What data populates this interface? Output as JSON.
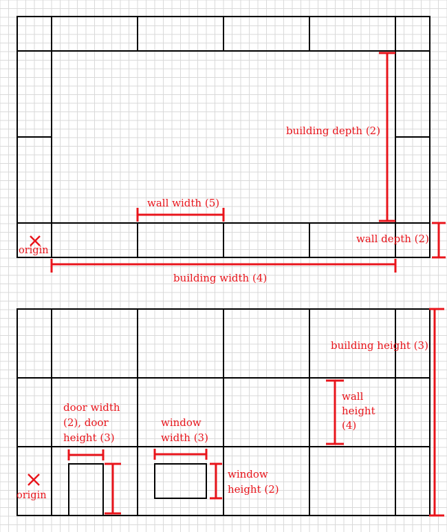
{
  "colors": {
    "background": "#ffffff",
    "grid": "#d9d9d9",
    "wall_outline": "#000000",
    "annotation": "#e8141b"
  },
  "plan_view": {
    "building_depth": "building depth (2)",
    "wall_width": "wall width (5)",
    "wall_depth": "wall depth (2)",
    "building_width": "building width (4)",
    "origin": "origin"
  },
  "elevation_view": {
    "building_height": "building height (3)",
    "wall_height": [
      "wall",
      "height",
      "(4)"
    ],
    "door_size": [
      "door width",
      "(2), door",
      "height (3)"
    ],
    "window_width": [
      "window",
      "width (3)"
    ],
    "window_height": [
      "window",
      "height (2)"
    ],
    "origin": "origin"
  }
}
